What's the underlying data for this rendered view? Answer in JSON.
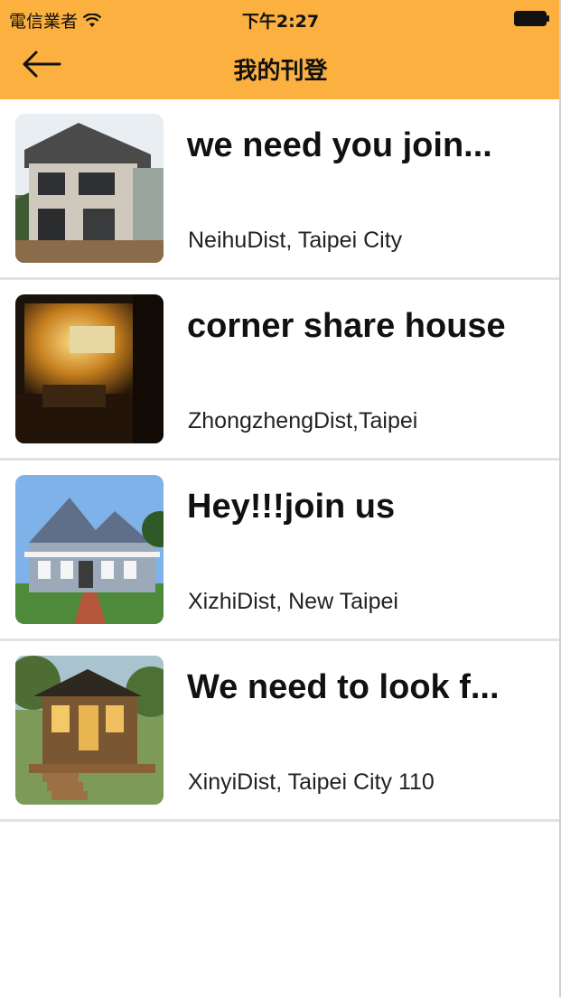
{
  "status_bar": {
    "carrier": "電信業者",
    "time": "下午2:27"
  },
  "nav": {
    "title": "我的刊登"
  },
  "colors": {
    "header": "#fbb040",
    "divider": "#e2e2e2"
  },
  "listings": [
    {
      "title": "we need you join...",
      "location": "NeihuDist, Taipei City",
      "image": "house-photo"
    },
    {
      "title": "corner share house",
      "location": "ZhongzhengDist,Taipei",
      "image": "room-photo"
    },
    {
      "title": "Hey!!!join us",
      "location": "XizhiDist, New Taipei",
      "image": "blue-house-photo"
    },
    {
      "title": "We need to look f...",
      "location": "XinyiDist, Taipei City 110",
      "image": "tiny-house-photo"
    }
  ]
}
